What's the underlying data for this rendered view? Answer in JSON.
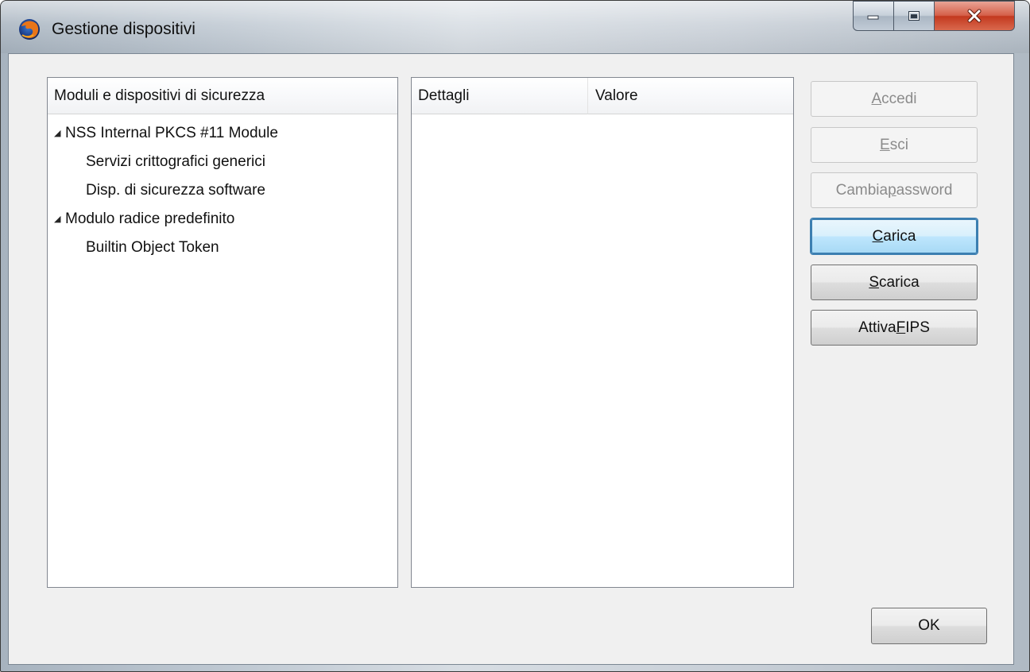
{
  "window": {
    "title": "Gestione dispositivi"
  },
  "tree": {
    "header": "Moduli e dispositivi di sicurezza",
    "rows": [
      {
        "label": "NSS Internal PKCS #11 Module",
        "expanded": true,
        "level": 0
      },
      {
        "label": "Servizi crittografici generici",
        "level": 1
      },
      {
        "label": "Disp. di sicurezza software",
        "level": 1
      },
      {
        "label": "Modulo radice predefinito",
        "expanded": true,
        "level": 0
      },
      {
        "label": "Builtin Object Token",
        "level": 1
      }
    ]
  },
  "details": {
    "columns": [
      "Dettagli",
      "Valore"
    ]
  },
  "buttons": {
    "login": {
      "pre": "",
      "accel": "A",
      "post": "ccedi",
      "enabled": false
    },
    "logout": {
      "pre": "",
      "accel": "E",
      "post": "sci",
      "enabled": false
    },
    "change_password": {
      "pre": "Cambia ",
      "accel": "p",
      "post": "assword",
      "enabled": false
    },
    "load": {
      "pre": "",
      "accel": "C",
      "post": "arica",
      "enabled": true
    },
    "unload": {
      "pre": "",
      "accel": "S",
      "post": "carica",
      "enabled": true
    },
    "fips": {
      "pre": "Attiva ",
      "accel": "F",
      "post": "IPS",
      "enabled": true
    },
    "ok": {
      "label": "OK",
      "enabled": true
    }
  },
  "icons": {
    "app": "firefox-icon",
    "twisty": "expanded-triangle-icon",
    "minimize": "minimize-icon",
    "maximize": "maximize-icon",
    "close": "close-icon"
  },
  "colors": {
    "close_button": "#c3391f",
    "default_button_border": "#3c7fb1"
  }
}
